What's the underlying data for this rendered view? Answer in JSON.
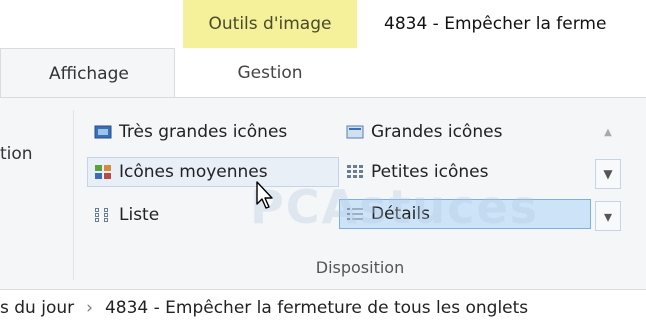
{
  "contextual_tab": {
    "label": "Outils d'image"
  },
  "title": "4834 - Empêcher la ferme",
  "tabs": [
    {
      "label": "Affichage",
      "active": true
    },
    {
      "label": "Gestion",
      "active": false
    }
  ],
  "ribbon": {
    "left_group_label": "tion",
    "layout_group": {
      "label": "Disposition",
      "items": [
        {
          "label": "Très grandes icônes",
          "icon": "extra-large-icons-icon"
        },
        {
          "label": "Grandes icônes",
          "icon": "large-icons-icon"
        },
        {
          "label": "Icônes moyennes",
          "icon": "medium-icons-icon",
          "state": "hover"
        },
        {
          "label": "Petites icônes",
          "icon": "small-icons-icon"
        },
        {
          "label": "Liste",
          "icon": "list-icon"
        },
        {
          "label": "Détails",
          "icon": "details-icon",
          "state": "selected"
        }
      ],
      "scroll": {
        "up": "▲",
        "down": "▼",
        "more": "▾"
      }
    }
  },
  "breadcrumb": {
    "items": [
      "s du jour",
      "4834 - Empêcher la fermeture de tous les onglets"
    ],
    "separator": "›"
  },
  "watermark": "PCAstuces",
  "colors": {
    "contextual_bg": "#f4f19a",
    "ribbon_bg": "#f5f6f7",
    "hover_bg": "#e8eff7",
    "selected_bg": "#cde3f7",
    "selected_border": "#7ab0e0"
  }
}
